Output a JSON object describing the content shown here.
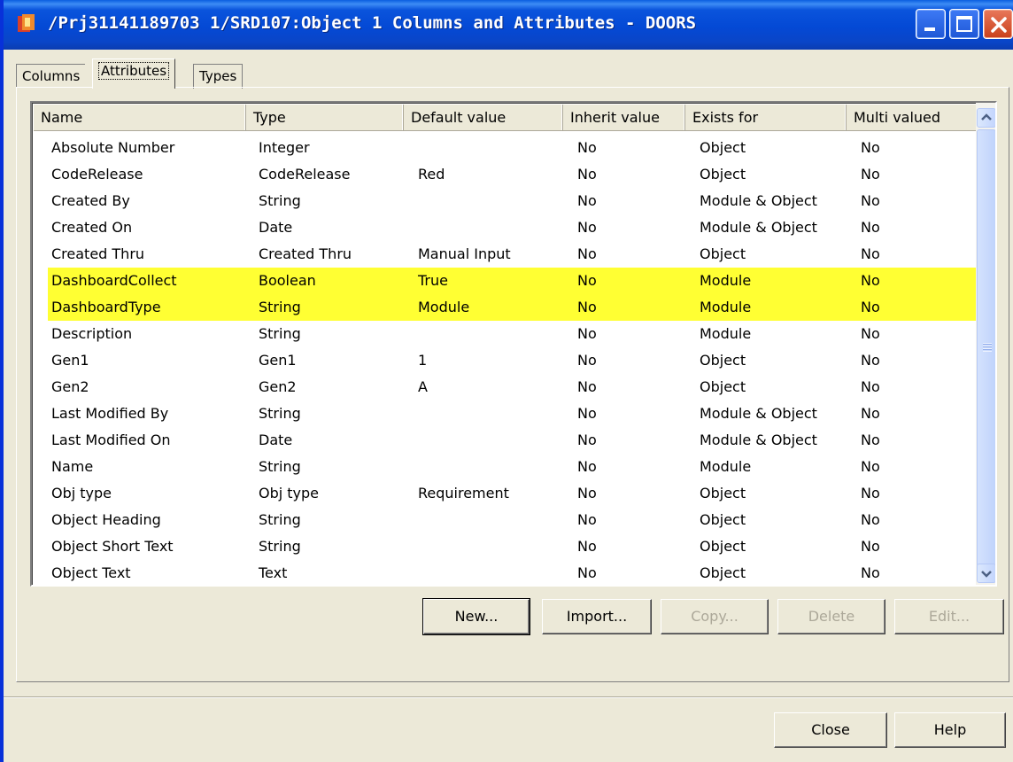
{
  "window": {
    "title": "/Prj31141189703  1/SRD107:Object 1 Columns and Attributes - DOORS"
  },
  "tabs": [
    {
      "label": "Columns"
    },
    {
      "label": "Attributes",
      "selected": true
    },
    {
      "label": "Types"
    }
  ],
  "table": {
    "columns": [
      "Name",
      "Type",
      "Default value",
      "Inherit value",
      "Exists for",
      "Multi valued"
    ],
    "rows": [
      [
        "Absolute Number",
        "Integer",
        "",
        "No",
        "Object",
        "No"
      ],
      [
        "CodeRelease",
        "CodeRelease",
        "Red",
        "No",
        "Object",
        "No"
      ],
      [
        "Created By",
        "String",
        "",
        "No",
        "Module & Object",
        "No"
      ],
      [
        "Created On",
        "Date",
        "",
        "No",
        "Module & Object",
        "No"
      ],
      [
        "Created Thru",
        "Created Thru",
        "Manual Input",
        "No",
        "Object",
        "No"
      ],
      [
        "DashboardCollect",
        "Boolean",
        "True",
        "No",
        "Module",
        "No"
      ],
      [
        "DashboardType",
        "String",
        "Module",
        "No",
        "Module",
        "No"
      ],
      [
        "Description",
        "String",
        "",
        "No",
        "Module",
        "No"
      ],
      [
        "Gen1",
        "Gen1",
        "1",
        "No",
        "Object",
        "No"
      ],
      [
        "Gen2",
        "Gen2",
        "A",
        "No",
        "Object",
        "No"
      ],
      [
        "Last Modified By",
        "String",
        "",
        "No",
        "Module & Object",
        "No"
      ],
      [
        "Last Modified On",
        "Date",
        "",
        "No",
        "Module & Object",
        "No"
      ],
      [
        "Name",
        "String",
        "",
        "No",
        "Module",
        "No"
      ],
      [
        "Obj type",
        "Obj type",
        "Requirement",
        "No",
        "Object",
        "No"
      ],
      [
        "Object Heading",
        "String",
        "",
        "No",
        "Object",
        "No"
      ],
      [
        "Object Short Text",
        "String",
        "",
        "No",
        "Object",
        "No"
      ],
      [
        "Object Text",
        "Text",
        "",
        "No",
        "Object",
        "No"
      ]
    ],
    "highlighted_rows": [
      5,
      6
    ],
    "highlight_color": "#ffff33"
  },
  "buttons": {
    "new": "New...",
    "import": "Import...",
    "copy": "Copy...",
    "delete": "Delete",
    "edit": "Edit...",
    "close": "Close",
    "help": "Help"
  },
  "icons": {
    "app": "doors-app-icon",
    "minimize": "minimize-icon",
    "maximize": "maximize-icon",
    "close": "close-icon",
    "scroll_up": "chevron-up-icon",
    "scroll_down": "chevron-down-icon"
  },
  "colors": {
    "titlebar": "#0a54dc",
    "dialog_bg": "#ece9d8",
    "highlight": "#ffff33",
    "disabled_text": "#aca899"
  }
}
